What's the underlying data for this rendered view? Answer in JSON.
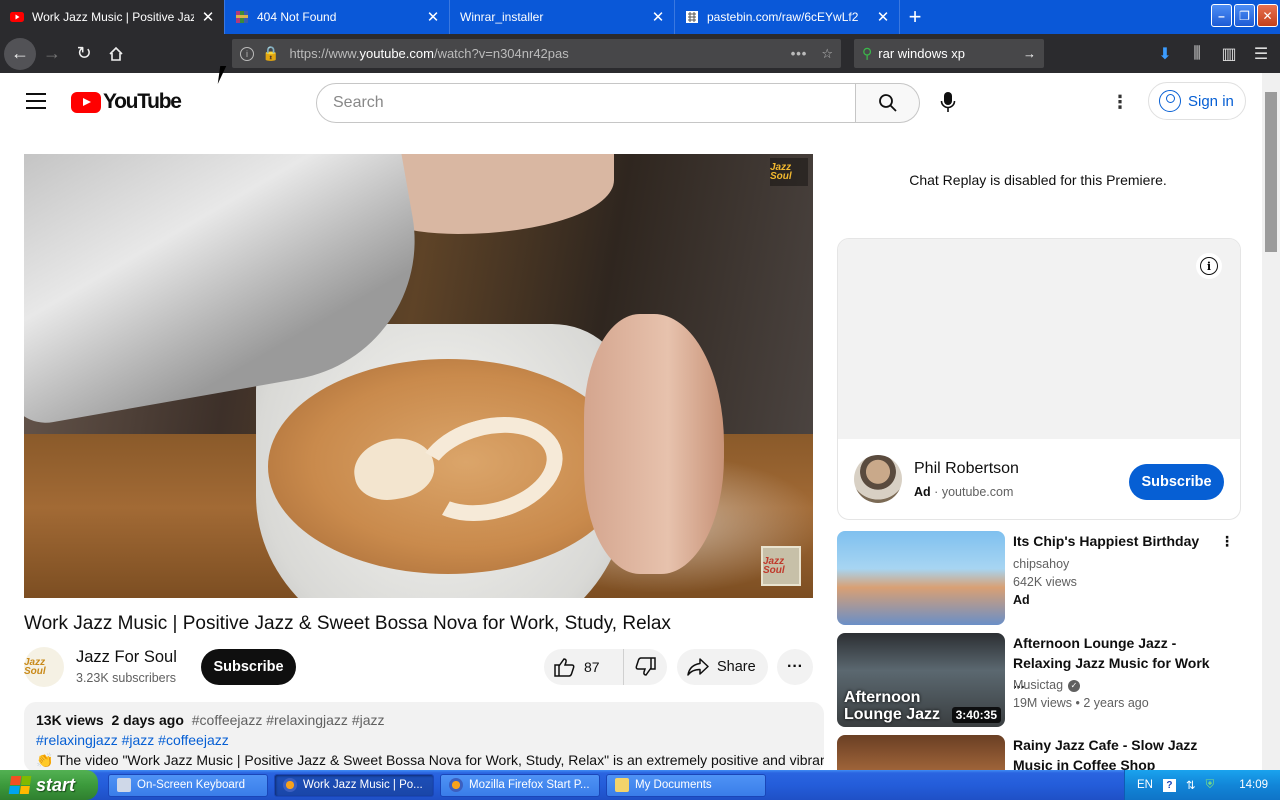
{
  "browser": {
    "tabs": [
      {
        "title": "Work Jazz Music | Positive Jazz & Sweet Bossa Nova",
        "active": true,
        "favicon": "youtube-icon"
      },
      {
        "title": "404 Not Found",
        "active": false,
        "favicon": "rar-icon"
      },
      {
        "title": "Winrar_installer",
        "active": false,
        "favicon": "none"
      },
      {
        "title": "pastebin.com/raw/6cEYwLf2",
        "active": false,
        "favicon": "pastebin-icon"
      }
    ],
    "url_prefix": "https://www.",
    "url_domain": "youtube.com",
    "url_path": "/watch?v=n304nr42pas",
    "search_value": "rar windows xp"
  },
  "youtube": {
    "logo_text": "YouTube",
    "search_placeholder": "Search",
    "signin_label": "Sign in",
    "video": {
      "title": "Work Jazz Music | Positive Jazz & Sweet Bossa Nova for Work, Study, Relax",
      "watermark_text": "Jazz Soul",
      "channel_logo_text": "Jazz Soul",
      "channel_name": "Jazz For Soul",
      "subscribers": "3.23K subscribers",
      "subscribe_label": "Subscribe",
      "like_count": "87",
      "share_label": "Share",
      "more_label": "···",
      "views": "13K views",
      "age": "2 days ago",
      "tags_line1": "#coffeejazz #relaxingjazz #jazz",
      "tags_line2": "#relaxingjazz #jazz #coffeejazz",
      "description_line": "👏 The video \"Work Jazz Music | Positive Jazz & Sweet Bossa Nova for Work, Study, Relax\" is an extremely positive and vibrant"
    },
    "chat_note": "Chat Replay is disabled for this Premiere.",
    "ad": {
      "info_icon_text": "i",
      "name": "Phil Robertson",
      "label": "Ad",
      "separator": "·",
      "domain": "youtube.com",
      "subscribe_label": "Subscribe"
    },
    "recommendations": [
      {
        "title": "Its Chip's Happiest Birthday",
        "channel": "chipsahoy",
        "views": "642K views",
        "ad_label": "Ad",
        "duration": ""
      },
      {
        "title": "Afternoon Lounge Jazz - Relaxing Jazz Music for Work ...",
        "channel": "Musictag",
        "views": "19M views",
        "age": "2 years ago",
        "duration": "3:40:35",
        "thumb_text": "Afternoon Lounge Jazz"
      },
      {
        "title": "Rainy Jazz Cafe - Slow Jazz Music in Coffee Shop Ambien...",
        "channel": "",
        "views": "",
        "duration": ""
      }
    ]
  },
  "taskbar": {
    "start_label": "start",
    "items": [
      {
        "label": "On-Screen Keyboard",
        "active": false
      },
      {
        "label": "Work Jazz Music | Po...",
        "active": true
      },
      {
        "label": "Mozilla Firefox Start P...",
        "active": false
      },
      {
        "label": "My Documents",
        "active": false
      }
    ],
    "language": "EN",
    "help_icon_text": "?",
    "clock": "14:09"
  },
  "colors": {
    "yt_red": "#ff0000",
    "yt_blue": "#065fd4",
    "xp_taskbar": "#245dda",
    "xp_start": "#3c9a3c",
    "firefox_dark": "#2b2b2e"
  }
}
